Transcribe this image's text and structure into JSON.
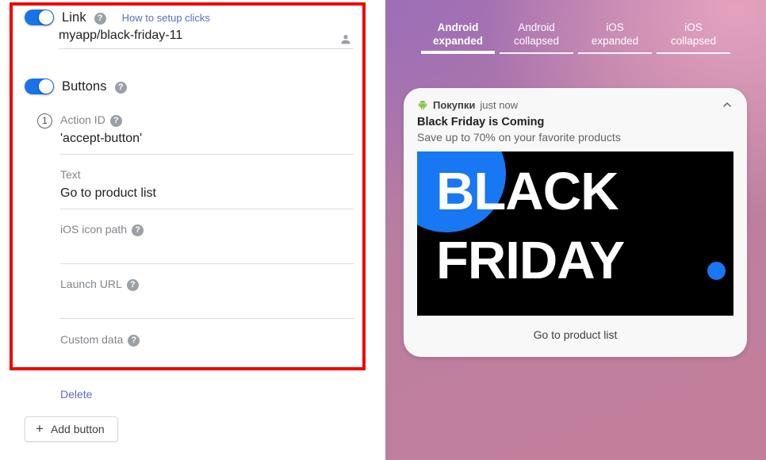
{
  "editor": {
    "link_section": {
      "toggle_label": "Link",
      "toggle_on": true,
      "help_icon": "help-icon",
      "setup_link": "How to setup clicks",
      "value": "myapp/black-friday-11",
      "person_icon": "person-icon"
    },
    "buttons_section": {
      "toggle_label": "Buttons",
      "toggle_on": true,
      "help_icon": "help-icon"
    },
    "button_item": {
      "index": "1",
      "fields": [
        {
          "label": "Action ID",
          "has_help": true,
          "value": "'accept-button'"
        },
        {
          "label": "Text",
          "has_help": false,
          "value": "Go to product list"
        },
        {
          "label": "iOS icon path",
          "has_help": true,
          "value": ""
        },
        {
          "label": "Launch URL",
          "has_help": true,
          "value": ""
        },
        {
          "label": "Custom data",
          "has_help": true,
          "value": ""
        }
      ]
    },
    "delete_label": "Delete",
    "add_button_label": "Add button",
    "add_button_plus": "+",
    "accent_color": "#1a73e8",
    "link_color": "#5c6bc0",
    "highlight_border_color": "#ee0000"
  },
  "preview": {
    "tabs": [
      {
        "line1": "Android",
        "line2": "expanded",
        "active": true
      },
      {
        "line1": "Android",
        "line2": "collapsed",
        "active": false
      },
      {
        "line1": "iOS",
        "line2": "expanded",
        "active": false
      },
      {
        "line1": "iOS",
        "line2": "collapsed",
        "active": false
      }
    ],
    "notification": {
      "app_icon": "android-robot-icon",
      "app_name": "Покупки",
      "time": "just now",
      "collapse_icon": "chevron-up-icon",
      "title": "Black Friday is Coming",
      "body": "Save up to 70% on your favorite products",
      "image": {
        "line1": "BLACK",
        "line2": "FRIDAY",
        "background_color": "#000000",
        "accent_color": "#1877f2"
      },
      "action_label": "Go to product list"
    }
  }
}
